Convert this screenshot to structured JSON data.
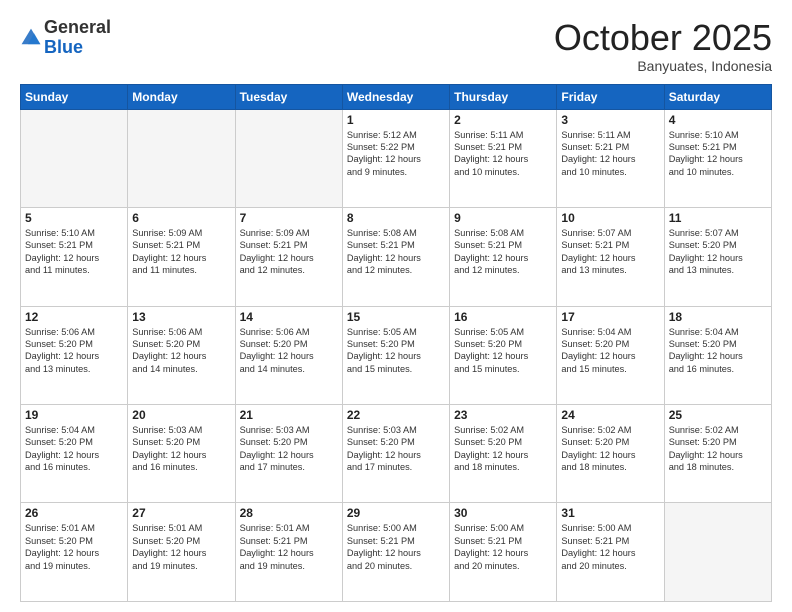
{
  "header": {
    "logo_general": "General",
    "logo_blue": "Blue",
    "month": "October 2025",
    "location": "Banyuates, Indonesia"
  },
  "weekdays": [
    "Sunday",
    "Monday",
    "Tuesday",
    "Wednesday",
    "Thursday",
    "Friday",
    "Saturday"
  ],
  "weeks": [
    [
      {
        "day": "",
        "text": ""
      },
      {
        "day": "",
        "text": ""
      },
      {
        "day": "",
        "text": ""
      },
      {
        "day": "1",
        "text": "Sunrise: 5:12 AM\nSunset: 5:22 PM\nDaylight: 12 hours\nand 9 minutes."
      },
      {
        "day": "2",
        "text": "Sunrise: 5:11 AM\nSunset: 5:21 PM\nDaylight: 12 hours\nand 10 minutes."
      },
      {
        "day": "3",
        "text": "Sunrise: 5:11 AM\nSunset: 5:21 PM\nDaylight: 12 hours\nand 10 minutes."
      },
      {
        "day": "4",
        "text": "Sunrise: 5:10 AM\nSunset: 5:21 PM\nDaylight: 12 hours\nand 10 minutes."
      }
    ],
    [
      {
        "day": "5",
        "text": "Sunrise: 5:10 AM\nSunset: 5:21 PM\nDaylight: 12 hours\nand 11 minutes."
      },
      {
        "day": "6",
        "text": "Sunrise: 5:09 AM\nSunset: 5:21 PM\nDaylight: 12 hours\nand 11 minutes."
      },
      {
        "day": "7",
        "text": "Sunrise: 5:09 AM\nSunset: 5:21 PM\nDaylight: 12 hours\nand 12 minutes."
      },
      {
        "day": "8",
        "text": "Sunrise: 5:08 AM\nSunset: 5:21 PM\nDaylight: 12 hours\nand 12 minutes."
      },
      {
        "day": "9",
        "text": "Sunrise: 5:08 AM\nSunset: 5:21 PM\nDaylight: 12 hours\nand 12 minutes."
      },
      {
        "day": "10",
        "text": "Sunrise: 5:07 AM\nSunset: 5:21 PM\nDaylight: 12 hours\nand 13 minutes."
      },
      {
        "day": "11",
        "text": "Sunrise: 5:07 AM\nSunset: 5:20 PM\nDaylight: 12 hours\nand 13 minutes."
      }
    ],
    [
      {
        "day": "12",
        "text": "Sunrise: 5:06 AM\nSunset: 5:20 PM\nDaylight: 12 hours\nand 13 minutes."
      },
      {
        "day": "13",
        "text": "Sunrise: 5:06 AM\nSunset: 5:20 PM\nDaylight: 12 hours\nand 14 minutes."
      },
      {
        "day": "14",
        "text": "Sunrise: 5:06 AM\nSunset: 5:20 PM\nDaylight: 12 hours\nand 14 minutes."
      },
      {
        "day": "15",
        "text": "Sunrise: 5:05 AM\nSunset: 5:20 PM\nDaylight: 12 hours\nand 15 minutes."
      },
      {
        "day": "16",
        "text": "Sunrise: 5:05 AM\nSunset: 5:20 PM\nDaylight: 12 hours\nand 15 minutes."
      },
      {
        "day": "17",
        "text": "Sunrise: 5:04 AM\nSunset: 5:20 PM\nDaylight: 12 hours\nand 15 minutes."
      },
      {
        "day": "18",
        "text": "Sunrise: 5:04 AM\nSunset: 5:20 PM\nDaylight: 12 hours\nand 16 minutes."
      }
    ],
    [
      {
        "day": "19",
        "text": "Sunrise: 5:04 AM\nSunset: 5:20 PM\nDaylight: 12 hours\nand 16 minutes."
      },
      {
        "day": "20",
        "text": "Sunrise: 5:03 AM\nSunset: 5:20 PM\nDaylight: 12 hours\nand 16 minutes."
      },
      {
        "day": "21",
        "text": "Sunrise: 5:03 AM\nSunset: 5:20 PM\nDaylight: 12 hours\nand 17 minutes."
      },
      {
        "day": "22",
        "text": "Sunrise: 5:03 AM\nSunset: 5:20 PM\nDaylight: 12 hours\nand 17 minutes."
      },
      {
        "day": "23",
        "text": "Sunrise: 5:02 AM\nSunset: 5:20 PM\nDaylight: 12 hours\nand 18 minutes."
      },
      {
        "day": "24",
        "text": "Sunrise: 5:02 AM\nSunset: 5:20 PM\nDaylight: 12 hours\nand 18 minutes."
      },
      {
        "day": "25",
        "text": "Sunrise: 5:02 AM\nSunset: 5:20 PM\nDaylight: 12 hours\nand 18 minutes."
      }
    ],
    [
      {
        "day": "26",
        "text": "Sunrise: 5:01 AM\nSunset: 5:20 PM\nDaylight: 12 hours\nand 19 minutes."
      },
      {
        "day": "27",
        "text": "Sunrise: 5:01 AM\nSunset: 5:20 PM\nDaylight: 12 hours\nand 19 minutes."
      },
      {
        "day": "28",
        "text": "Sunrise: 5:01 AM\nSunset: 5:21 PM\nDaylight: 12 hours\nand 19 minutes."
      },
      {
        "day": "29",
        "text": "Sunrise: 5:00 AM\nSunset: 5:21 PM\nDaylight: 12 hours\nand 20 minutes."
      },
      {
        "day": "30",
        "text": "Sunrise: 5:00 AM\nSunset: 5:21 PM\nDaylight: 12 hours\nand 20 minutes."
      },
      {
        "day": "31",
        "text": "Sunrise: 5:00 AM\nSunset: 5:21 PM\nDaylight: 12 hours\nand 20 minutes."
      },
      {
        "day": "",
        "text": ""
      }
    ]
  ]
}
